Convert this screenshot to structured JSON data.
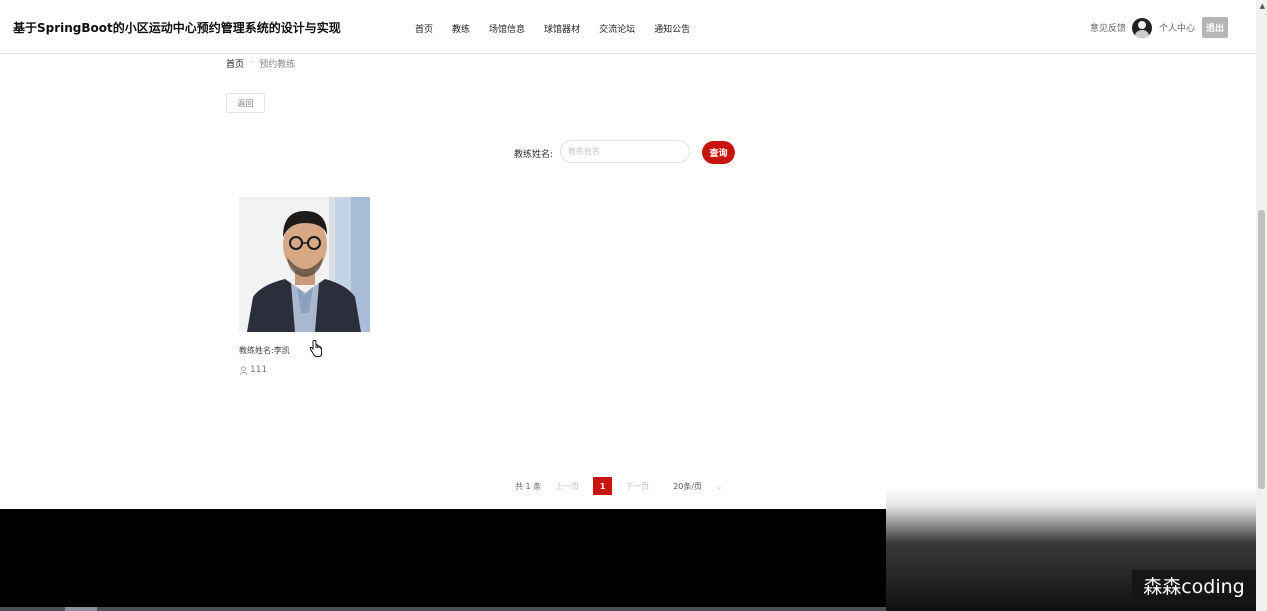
{
  "header": {
    "title": "基于SpringBoot的小区运动中心预约管理系统的设计与实现",
    "nav": [
      "首页",
      "教练",
      "场馆信息",
      "球馆器材",
      "交流论坛",
      "通知公告"
    ],
    "feedback": "意见反馈",
    "profile": "个人中心",
    "logout": "退出"
  },
  "breadcrumb": {
    "home": "首页",
    "separator": "-",
    "current": "预约教练"
  },
  "back_label": "返回",
  "search": {
    "label": "教练姓名:",
    "placeholder": "教练姓名",
    "button": "查询"
  },
  "cards": [
    {
      "name": "教练姓名:李凯",
      "count": "111"
    }
  ],
  "pagination": {
    "total": "共 1 条",
    "prev": "上一页",
    "current": "1",
    "next": "下一页",
    "page_size": "20条/页"
  },
  "watermark": "森森coding",
  "colors": {
    "accent": "#c8140e"
  }
}
